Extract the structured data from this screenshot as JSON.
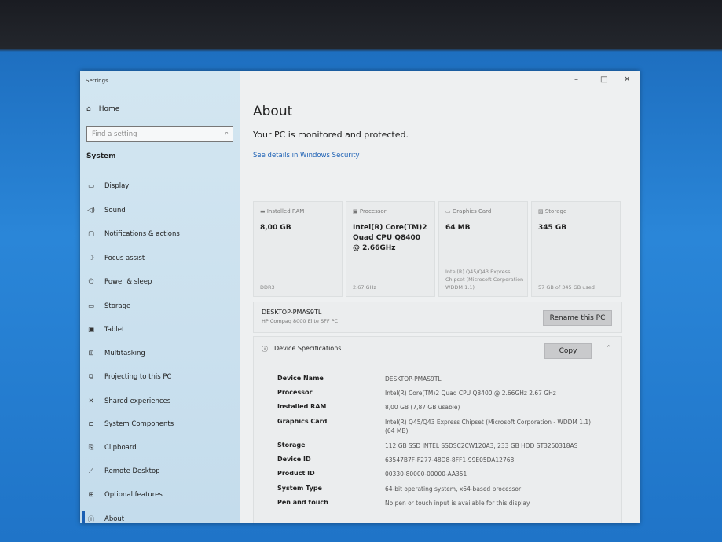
{
  "window": {
    "title": "Settings"
  },
  "sidebar": {
    "home": "Home",
    "search_placeholder": "Find a setting",
    "section": "System",
    "items": [
      {
        "label": "Display",
        "icon": "monitor-icon"
      },
      {
        "label": "Sound",
        "icon": "speaker-icon"
      },
      {
        "label": "Notifications & actions",
        "icon": "notification-icon"
      },
      {
        "label": "Focus assist",
        "icon": "moon-icon"
      },
      {
        "label": "Power & sleep",
        "icon": "power-icon"
      },
      {
        "label": "Storage",
        "icon": "storage-icon"
      },
      {
        "label": "Tablet",
        "icon": "tablet-icon"
      },
      {
        "label": "Multitasking",
        "icon": "multitasking-icon"
      },
      {
        "label": "Projecting to this PC",
        "icon": "projecting-icon"
      },
      {
        "label": "Shared experiences",
        "icon": "shared-icon"
      },
      {
        "label": "System Components",
        "icon": "components-icon"
      },
      {
        "label": "Clipboard",
        "icon": "clipboard-icon"
      },
      {
        "label": "Remote Desktop",
        "icon": "remote-icon"
      },
      {
        "label": "Optional features",
        "icon": "features-icon"
      },
      {
        "label": "About",
        "icon": "info-icon"
      }
    ]
  },
  "main": {
    "title": "About",
    "protection": "Your PC is monitored and protected.",
    "security_link": "See details in Windows Security",
    "cards": [
      {
        "label": "Installed RAM",
        "value": "8,00 GB",
        "sub": "DDR3"
      },
      {
        "label": "Processor",
        "value": "Intel(R) Core(TM)2 Quad CPU    Q8400 @ 2.66GHz",
        "sub": "2.67 GHz"
      },
      {
        "label": "Graphics Card",
        "value": "64 MB",
        "sub": "Intel(R) Q45/Q43 Express Chipset (Microsoft Corporation - WDDM 1.1)"
      },
      {
        "label": "Storage",
        "value": "345 GB",
        "sub": "57 GB of 345 GB used"
      }
    ],
    "pc_name": "DESKTOP-PMAS9TL",
    "pc_model": "HP Compaq 8000 Elite SFF PC",
    "rename_button": "Rename this PC",
    "specs_title": "Device Specifications",
    "copy_button": "Copy",
    "specs": [
      {
        "k": "Device Name",
        "v": "DESKTOP-PMAS9TL"
      },
      {
        "k": "Processor",
        "v": "Intel(R) Core(TM)2 Quad CPU    Q8400  @ 2.66GHz   2.67 GHz"
      },
      {
        "k": "Installed RAM",
        "v": "8,00 GB (7,87 GB usable)"
      },
      {
        "k": "Graphics Card",
        "v": "Intel(R) Q45/Q43 Express Chipset (Microsoft Corporation - WDDM 1.1) (64 MB)"
      },
      {
        "k": "Storage",
        "v": "112 GB SSD INTEL SSDSC2CW120A3, 233 GB HDD ST3250318AS"
      },
      {
        "k": "Device ID",
        "v": "63547B7F-F277-48D8-8FF1-99E05DA12768"
      },
      {
        "k": "Product ID",
        "v": "00330-80000-00000-AA351"
      },
      {
        "k": "System Type",
        "v": "64-bit operating system, x64-based processor"
      },
      {
        "k": "Pen and touch",
        "v": "No pen or touch input is available for this display"
      }
    ]
  }
}
